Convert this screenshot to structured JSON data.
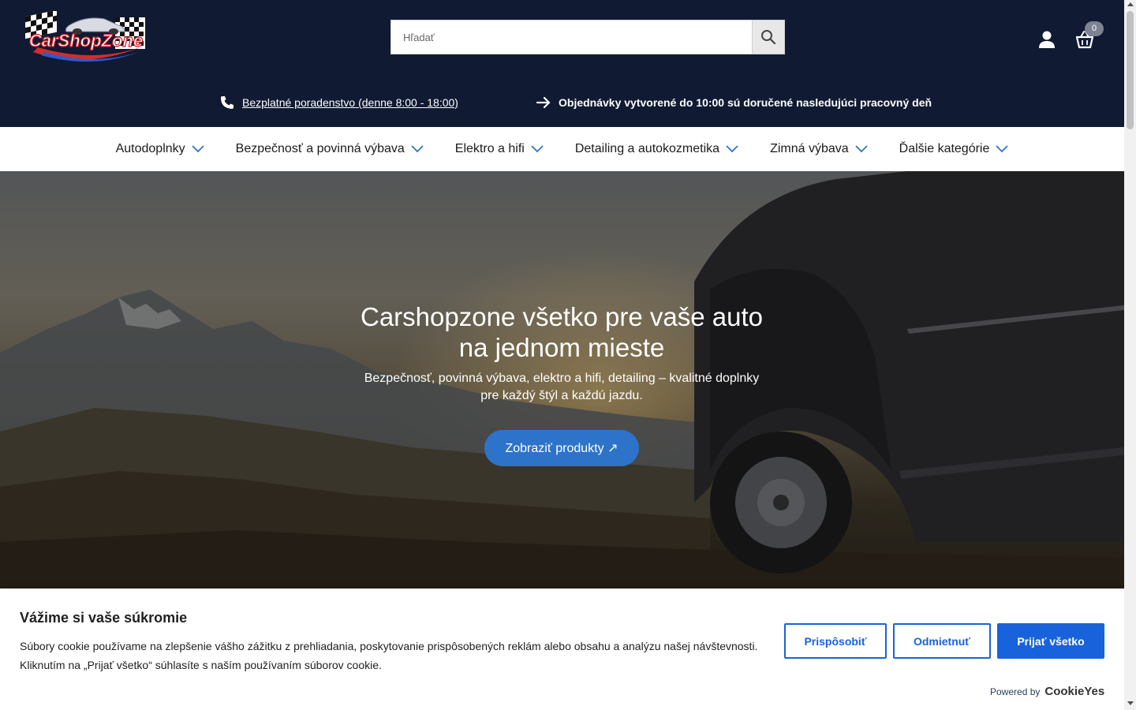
{
  "header": {
    "logo_text": "CarShopZone",
    "search": {
      "placeholder": "Hľadať",
      "value": ""
    },
    "cart_count": "0",
    "info": {
      "phone_link": "Bezplatné poradenstvo (denne 8:00 - 18:00)",
      "delivery": "Objednávky vytvorené do 10:00 sú doručené nasledujúci pracovný deň"
    }
  },
  "nav": {
    "items": [
      {
        "label": "Autodoplnky"
      },
      {
        "label": "Bezpečnosť a povinná výbava"
      },
      {
        "label": "Elektro a hifi"
      },
      {
        "label": "Detailing a autokozmetika"
      },
      {
        "label": "Zimná výbava"
      },
      {
        "label": "Ďalšie kategórie"
      }
    ]
  },
  "hero": {
    "title_line1": "Carshopzone všetko pre vaše auto",
    "title_line2": "na jednom mieste",
    "subtitle_line1": "Bezpečnosť, povinná výbava, elektro a hifi, detailing – kvalitné doplnky",
    "subtitle_line2": "pre každý štýl a každú jazdu.",
    "cta_label": "Zobraziť produkty ↗"
  },
  "cookie_banner": {
    "title": "Vážime si vaše súkromie",
    "text_line1": "Súbory cookie používame na zlepšenie vášho zážitku z prehliadania, poskytovanie prispôsobených reklám alebo obsahu a analýzu našej návštevnosti.",
    "text_line2": "Kliknutím na „Prijať všetko“ súhlasíte s naším používaním súborov cookie.",
    "customize_label": "Prispôsobiť",
    "reject_label": "Odmietnuť",
    "accept_label": "Prijať všetko",
    "powered_by": "Powered by",
    "powered_brand": "CookieYes"
  },
  "colors": {
    "header_bg": "#101a33",
    "accent_blue": "#1863dc",
    "nav_chevron": "#2d73c9",
    "hero_button": "#2d73c9"
  }
}
